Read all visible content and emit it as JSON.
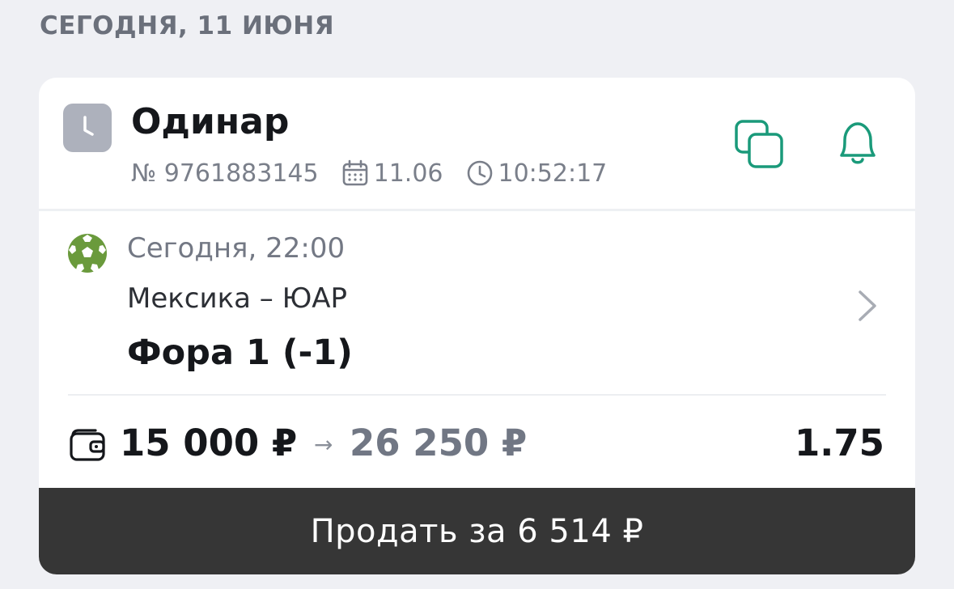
{
  "date_header": "СЕГОДНЯ, 11 ИЮНЯ",
  "bet": {
    "type": "Одинар",
    "number": "№ 9761883145",
    "date": "11.06",
    "time": "10:52:17",
    "status_icon": "clock-icon"
  },
  "actions": {
    "copy_icon": "copy-icon",
    "notify_icon": "bell-icon"
  },
  "event": {
    "sport_icon": "football-icon",
    "start": "Сегодня, 22:00",
    "teams": "Мексика – ЮАР",
    "market": "Фора 1 (-1)"
  },
  "amounts": {
    "stake": "15 000 ₽",
    "arrow": "→",
    "payout": "26 250 ₽",
    "odds": "1.75"
  },
  "sell_button": "Продать за 6 514 ₽",
  "colors": {
    "background": "#eff0f4",
    "accent": "#1a9a7a",
    "sport_green": "#6a9a3c",
    "sell_button_bg": "#363636"
  }
}
